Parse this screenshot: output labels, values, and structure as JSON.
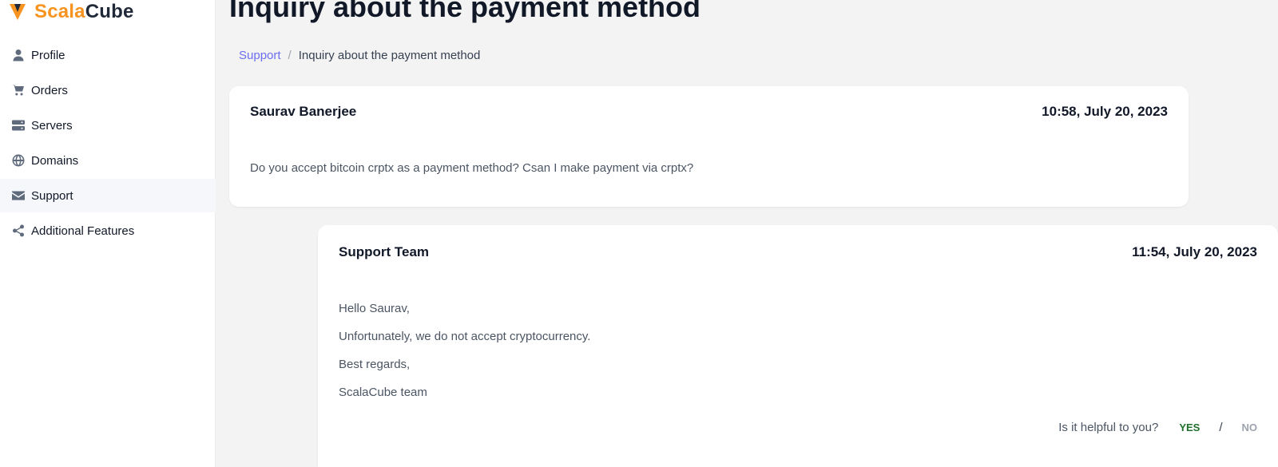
{
  "logo": {
    "part1": "Scala",
    "part2": "Cube",
    "accent": "#f7931e"
  },
  "sidebar": {
    "items": [
      {
        "label": "Profile",
        "icon": "user-icon"
      },
      {
        "label": "Orders",
        "icon": "cart-icon"
      },
      {
        "label": "Servers",
        "icon": "server-icon"
      },
      {
        "label": "Domains",
        "icon": "globe-icon"
      },
      {
        "label": "Support",
        "icon": "envelope-icon",
        "active": true
      },
      {
        "label": "Additional Features",
        "icon": "share-icon"
      }
    ]
  },
  "page": {
    "title": "Inquiry about the payment method"
  },
  "breadcrumb": {
    "link": "Support",
    "separator": "/",
    "current": "Inquiry about the payment method"
  },
  "messages": [
    {
      "author": "Saurav Banerjee",
      "time": "10:58, July 20, 2023",
      "lines": [
        "Do you accept bitcoin crptx as a payment method? Csan I make payment via crptx?"
      ]
    },
    {
      "author": "Support Team",
      "time": "11:54, July 20, 2023",
      "lines": [
        "Hello Saurav,",
        "Unfortunately, we do not accept cryptocurrency.",
        "Best regards,",
        "ScalaCube team"
      ]
    }
  ],
  "feedback": {
    "question": "Is it helpful to you?",
    "yes": "YES",
    "separator": "/",
    "no": "NO"
  }
}
